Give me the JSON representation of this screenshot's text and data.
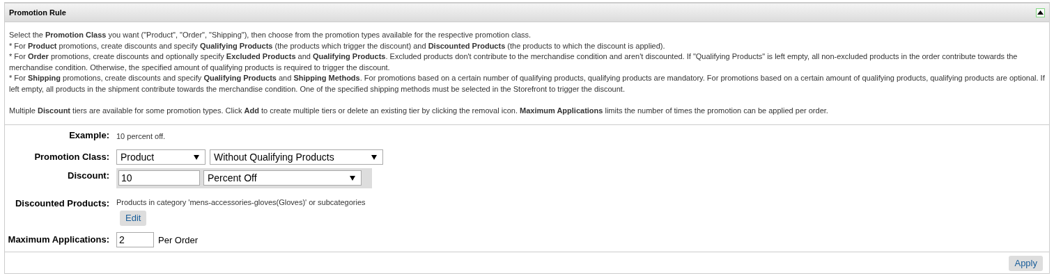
{
  "panel": {
    "title": "Promotion Rule",
    "collapsed": false
  },
  "description": [
    "Select the **Promotion Class** you want (\"Product\", \"Order\", \"Shipping\"), then choose from the promotion types available for the respective promotion class.",
    "* For **Product** promotions, create discounts and specify **Qualifying Products** (the products which trigger the discount) and **Discounted Products** (the products to which the discount is applied).",
    "* For **Order** promotions, create discounts and optionally specify **Excluded Products** and **Qualifying Products**. Excluded products don't contribute to the merchandise condition and aren't discounted. If \"Qualifying Products\" is left empty, all non-excluded products in the order contribute towards the merchandise condition. Otherwise, the specified amount of qualifying products is required to trigger the discount.",
    "* For **Shipping** promotions, create discounts and specify **Qualifying Products** and **Shipping Methods**. For promotions based on a certain number of qualifying products, qualifying products are mandatory. For promotions based on a certain amount of qualifying products, qualifying products are optional. If left empty, all products in the shipment contribute towards the merchandise condition. One of the specified shipping methods must be selected in the Storefront to trigger the discount.",
    "Multiple **Discount** tiers are available for some promotion types. Click **Add** to create multiple tiers or delete an existing tier by clicking the removal icon. **Maximum Applications** limits the number of times the promotion can be applied per order."
  ],
  "form": {
    "example": {
      "label": "Example:",
      "value": "10 percent off."
    },
    "promotion_class": {
      "label": "Promotion Class:",
      "class_value": "Product",
      "type_value": "Without Qualifying Products"
    },
    "discount": {
      "label": "Discount:",
      "amount": "10",
      "type_value": "Percent Off"
    },
    "discounted_products": {
      "label": "Discounted Products:",
      "value": "Products in category 'mens-accessories-gloves(Gloves)' or subcategories",
      "button": "Edit"
    },
    "maximum_applications": {
      "label": "Maximum Applications:",
      "value": "2",
      "unit": "Per Order"
    }
  },
  "apply_button": "Apply"
}
